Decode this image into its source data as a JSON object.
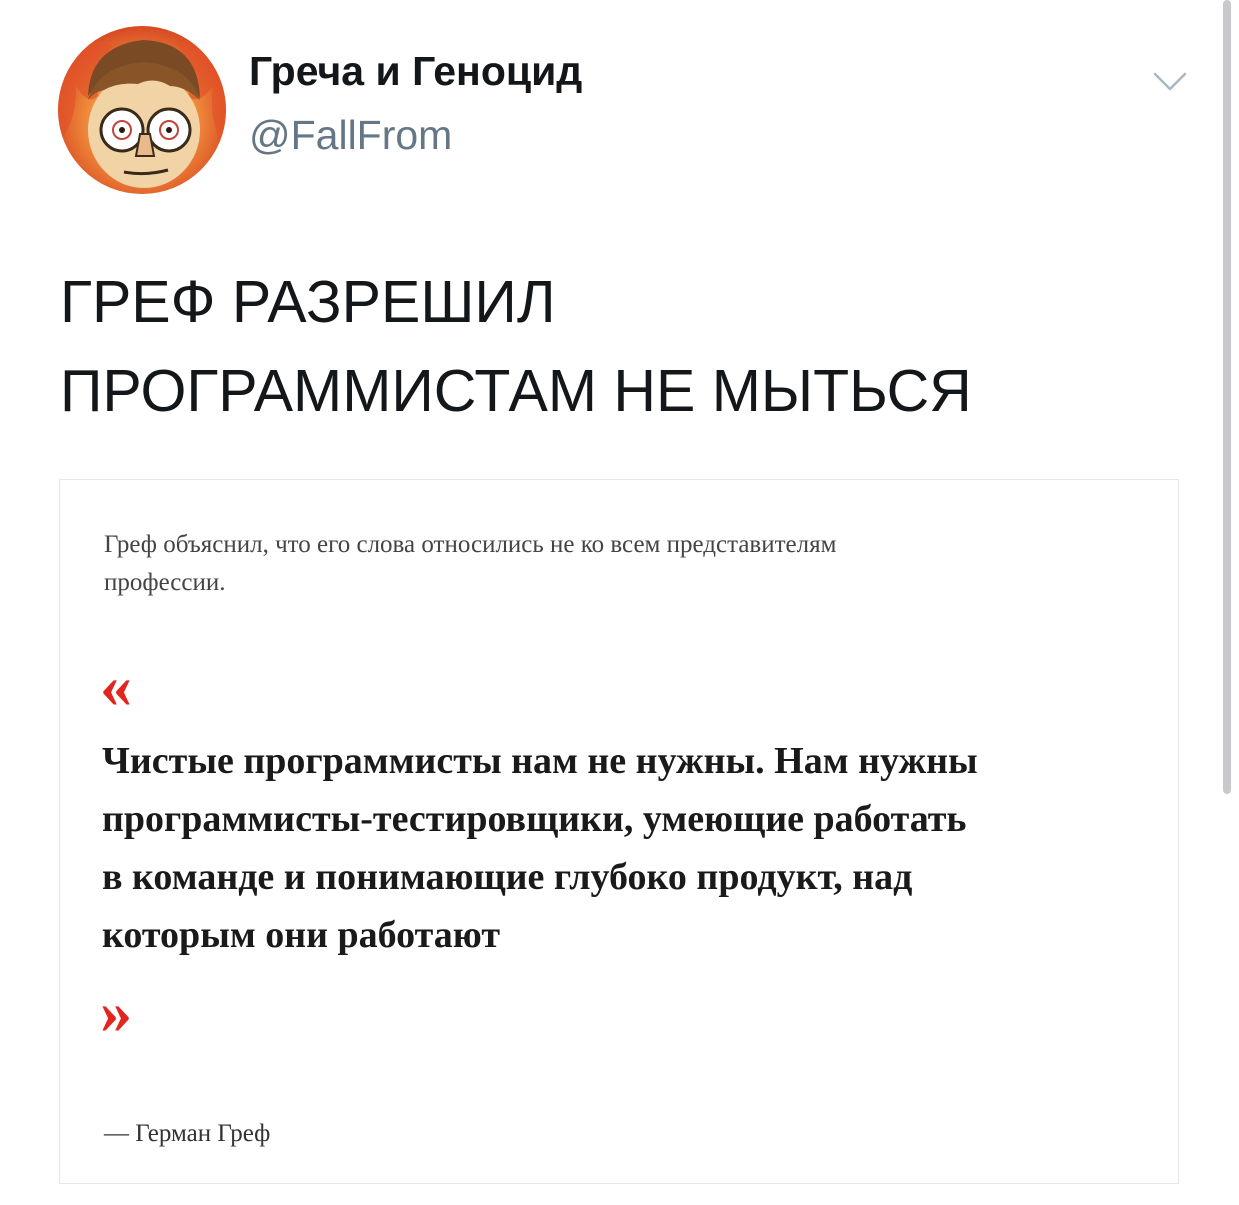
{
  "tweet": {
    "author_name": "Греча и Геноцид",
    "author_handle": "@FallFrom",
    "avatar_icon": "cartoon-avatar-icon",
    "menu_icon": "chevron-down-icon",
    "text_lines": [
      "ГРЕФ РАЗРЕШИЛ",
      "ПРОГРАММИСТАМ НЕ МЫТЬСЯ"
    ]
  },
  "card": {
    "lead_lines": [
      "Греф объяснил, что его слова относились не ко всем представителям",
      "профессии."
    ],
    "quote_open": "«",
    "quote_lines": [
      "Чистые программисты нам не нужны. Нам нужны",
      "программисты-тестировщики, умеющие работать",
      "в команде и понимающие глубоко продукт, над",
      "которым они работают"
    ],
    "quote_close": "»",
    "quote_author": "— Герман Греф",
    "accent_color": "#e2261d"
  }
}
